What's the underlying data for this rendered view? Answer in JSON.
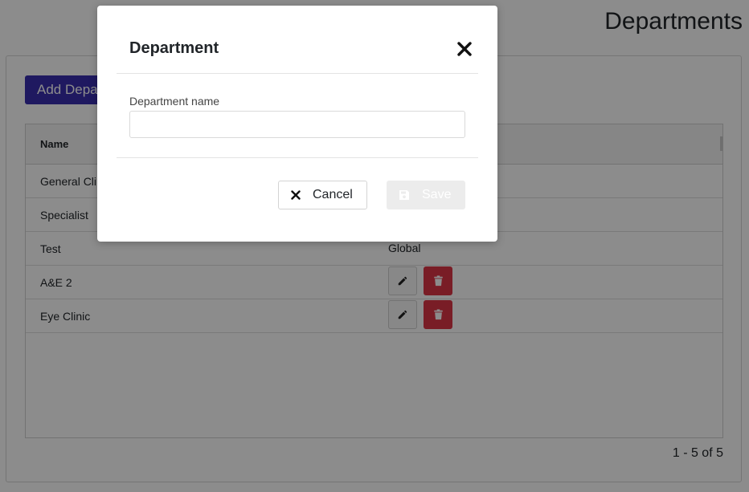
{
  "page": {
    "title": "Departments"
  },
  "toolbar": {
    "add_label": "Add Department"
  },
  "grid": {
    "columns": [
      "Name"
    ],
    "rows": [
      {
        "name": "General Clinic",
        "scope": "",
        "has_actions": false
      },
      {
        "name": "Specialist",
        "scope": "",
        "has_actions": false
      },
      {
        "name": "Test",
        "scope": "Global",
        "has_actions": false
      },
      {
        "name": "A&E 2",
        "scope": "",
        "has_actions": true
      },
      {
        "name": "Eye Clinic",
        "scope": "",
        "has_actions": true
      }
    ],
    "pager": "1 - 5 of 5"
  },
  "modal": {
    "title": "Department",
    "field_label": "Department name",
    "field_value": "",
    "field_placeholder": "",
    "cancel_label": "Cancel",
    "save_label": "Save",
    "save_enabled": false
  },
  "icons": {
    "close": "x-icon",
    "cancel": "x-icon",
    "save": "floppy-disk-icon",
    "edit": "pencil-icon",
    "delete": "trash-icon"
  },
  "colors": {
    "primary": "#3a2fb0",
    "danger": "#dc3545",
    "disabled": "#ececec"
  }
}
